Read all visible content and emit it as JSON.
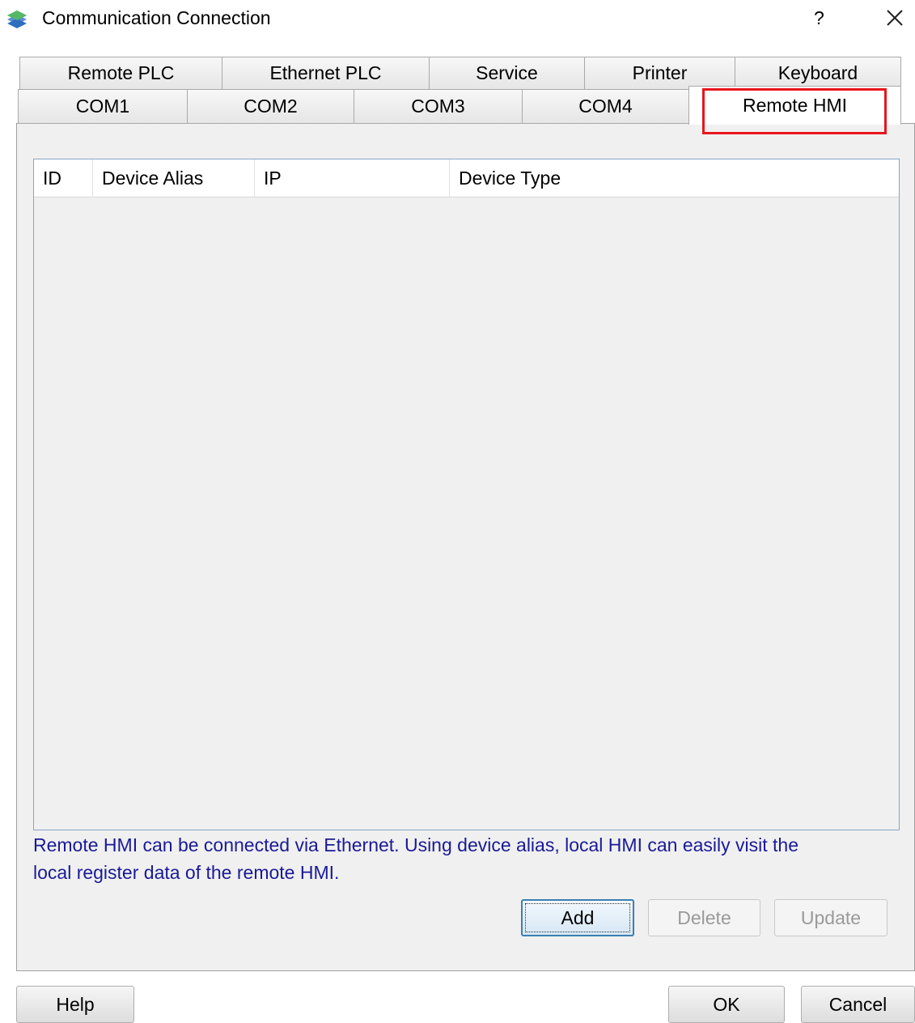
{
  "window": {
    "title": "Communication Connection",
    "help_glyph": "?",
    "close_icon": "close-icon",
    "app_icon": "stacked-layers-icon"
  },
  "tabs_row1": [
    "Remote PLC",
    "Ethernet PLC",
    "Service",
    "Printer",
    "Keyboard"
  ],
  "tabs_row2": [
    "COM1",
    "COM2",
    "COM3",
    "COM4",
    "Remote HMI"
  ],
  "active_tab": "Remote HMI",
  "table": {
    "columns": [
      "ID",
      "Device Alias",
      "IP",
      "Device Type"
    ],
    "rows": []
  },
  "note": {
    "line1": "Remote HMI can be connected via Ethernet. Using device alias, local HMI can easily visit the",
    "line2": "local register data of the remote HMI."
  },
  "buttons": {
    "add": "Add",
    "delete": "Delete",
    "update": "Update",
    "help": "Help",
    "ok": "OK",
    "cancel": "Cancel"
  },
  "colors": {
    "highlight": "#e8141c",
    "note_text": "#1a1a99",
    "panel_bg": "#f0f0f0"
  }
}
